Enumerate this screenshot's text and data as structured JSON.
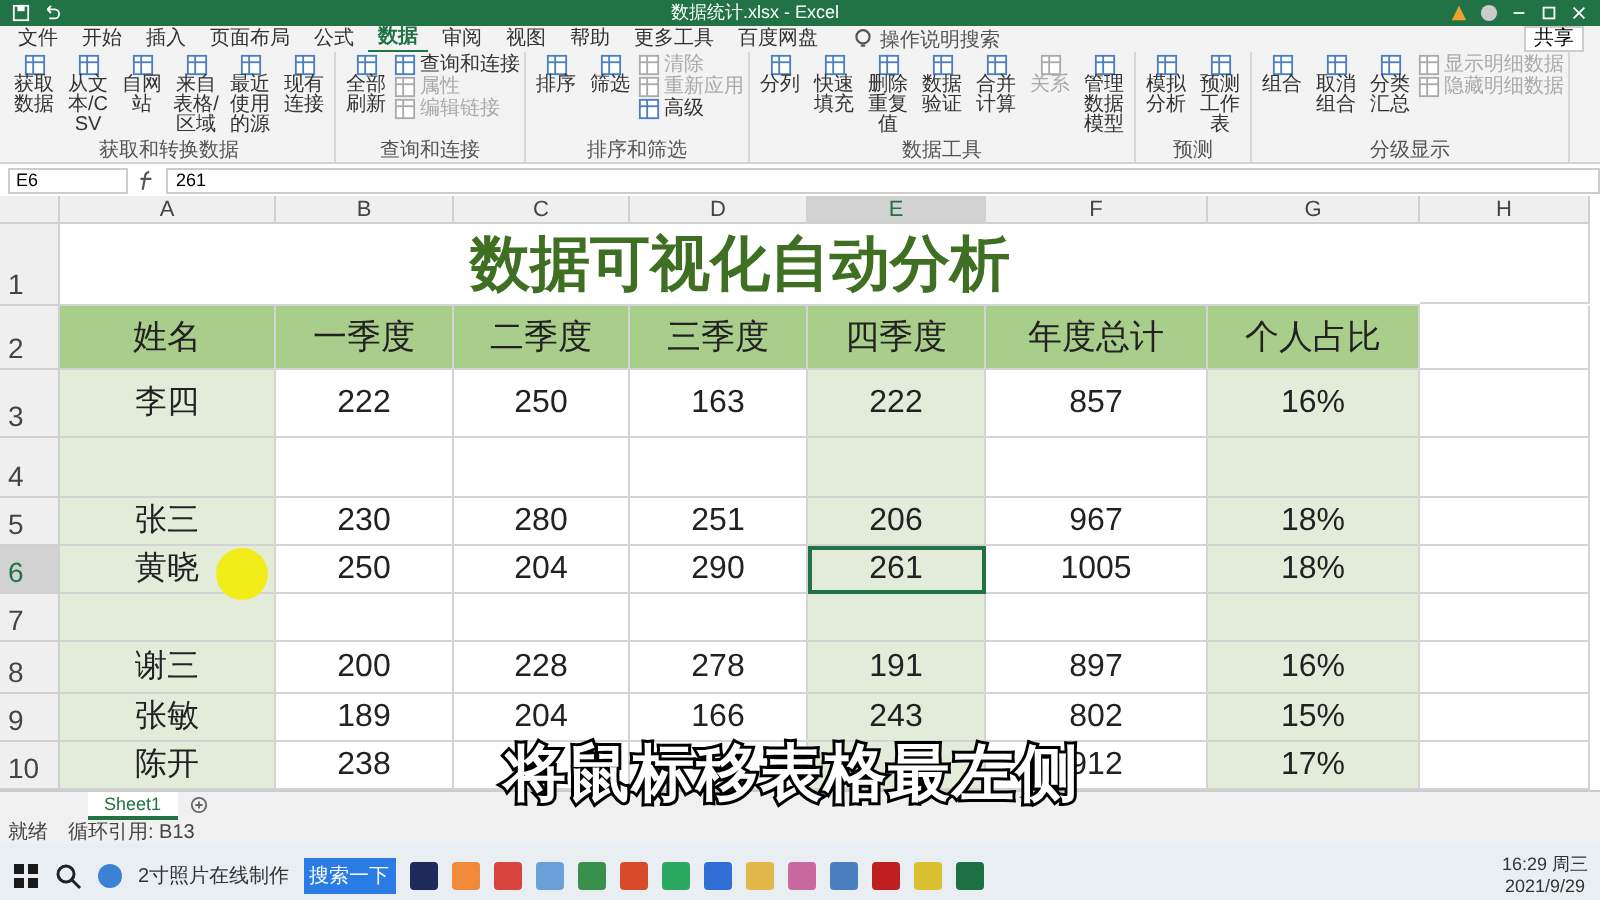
{
  "window": {
    "title": "数据统计.xlsx  -  Excel"
  },
  "tabs": [
    {
      "label": "文件",
      "selected": false
    },
    {
      "label": "开始",
      "selected": false
    },
    {
      "label": "插入",
      "selected": false
    },
    {
      "label": "页面布局",
      "selected": false
    },
    {
      "label": "公式",
      "selected": false
    },
    {
      "label": "数据",
      "selected": true
    },
    {
      "label": "审阅",
      "selected": false
    },
    {
      "label": "视图",
      "selected": false
    },
    {
      "label": "帮助",
      "selected": false
    },
    {
      "label": "更多工具",
      "selected": false
    },
    {
      "label": "百度网盘",
      "selected": false
    }
  ],
  "tell_me": {
    "placeholder": "操作说明搜索"
  },
  "share": "共享",
  "ribbon": [
    {
      "label": "获取和转换数据",
      "items": [
        {
          "label": "获取数据",
          "kind": "large",
          "disabled": false
        },
        {
          "label": "从文本/CSV",
          "kind": "large",
          "disabled": false
        },
        {
          "label": "自网站",
          "kind": "large",
          "disabled": false
        },
        {
          "label": "来自表格/区域",
          "kind": "large",
          "disabled": false
        },
        {
          "label": "最近使用的源",
          "kind": "large",
          "disabled": false
        },
        {
          "label": "现有连接",
          "kind": "large",
          "disabled": false
        }
      ]
    },
    {
      "label": "查询和连接",
      "items": [
        {
          "label": "全部刷新",
          "kind": "large",
          "disabled": false
        },
        {
          "label": "查询和连接",
          "kind": "small",
          "disabled": false
        },
        {
          "label": "属性",
          "kind": "small",
          "disabled": true
        },
        {
          "label": "编辑链接",
          "kind": "small",
          "disabled": true
        }
      ]
    },
    {
      "label": "排序和筛选",
      "items": [
        {
          "label": "排序",
          "kind": "large",
          "disabled": false
        },
        {
          "label": "筛选",
          "kind": "large",
          "disabled": false
        },
        {
          "label": "清除",
          "kind": "small",
          "disabled": true
        },
        {
          "label": "重新应用",
          "kind": "small",
          "disabled": true
        },
        {
          "label": "高级",
          "kind": "small",
          "disabled": false
        }
      ]
    },
    {
      "label": "数据工具",
      "items": [
        {
          "label": "分列",
          "kind": "large",
          "disabled": false
        },
        {
          "label": "快速填充",
          "kind": "large",
          "disabled": false
        },
        {
          "label": "删除重复值",
          "kind": "large",
          "disabled": false
        },
        {
          "label": "数据验证",
          "kind": "large",
          "disabled": false
        },
        {
          "label": "合并计算",
          "kind": "large",
          "disabled": false
        },
        {
          "label": "关系",
          "kind": "large",
          "disabled": true
        },
        {
          "label": "管理数据模型",
          "kind": "large",
          "disabled": false
        }
      ]
    },
    {
      "label": "预测",
      "items": [
        {
          "label": "模拟分析",
          "kind": "large",
          "disabled": false
        },
        {
          "label": "预测工作表",
          "kind": "large",
          "disabled": false
        }
      ]
    },
    {
      "label": "分级显示",
      "items": [
        {
          "label": "组合",
          "kind": "large",
          "disabled": false
        },
        {
          "label": "取消组合",
          "kind": "large",
          "disabled": false
        },
        {
          "label": "分类汇总",
          "kind": "large",
          "disabled": false
        },
        {
          "label": "显示明细数据",
          "kind": "small",
          "disabled": true
        },
        {
          "label": "隐藏明细数据",
          "kind": "small",
          "disabled": true
        }
      ]
    }
  ],
  "name_box": "E6",
  "formula": "261",
  "columns": [
    {
      "letter": "A",
      "shaded": true,
      "selected": false
    },
    {
      "letter": "B",
      "shaded": false,
      "selected": false
    },
    {
      "letter": "C",
      "shaded": false,
      "selected": false
    },
    {
      "letter": "D",
      "shaded": false,
      "selected": false
    },
    {
      "letter": "E",
      "shaded": true,
      "selected": true
    },
    {
      "letter": "F",
      "shaded": false,
      "selected": false
    },
    {
      "letter": "G",
      "shaded": true,
      "selected": false
    },
    {
      "letter": "H",
      "shaded": false,
      "selected": false
    }
  ],
  "rows": [
    {
      "label": "1",
      "kind": "title",
      "title": "数据可视化自动分析",
      "selected": false
    },
    {
      "label": "2",
      "kind": "header",
      "cells": [
        "姓名",
        "一季度",
        "二季度",
        "三季度",
        "四季度",
        "年度总计",
        "个人占比"
      ],
      "selected": false
    },
    {
      "label": "3",
      "kind": "data",
      "cells": [
        "李四",
        "222",
        "250",
        "163",
        "222",
        "857",
        "16%"
      ],
      "selected": false
    },
    {
      "label": "4",
      "kind": "data",
      "selected": false
    },
    {
      "label": "5",
      "kind": "data",
      "cells": [
        "张三",
        "230",
        "280",
        "251",
        "206",
        "967",
        "18%"
      ],
      "selected": false
    },
    {
      "label": "6",
      "kind": "data",
      "cells": [
        "黄晓",
        "250",
        "204",
        "290",
        "261",
        "1005",
        "18%"
      ],
      "selected": true
    },
    {
      "label": "7",
      "kind": "data",
      "selected": false
    },
    {
      "label": "8",
      "kind": "data",
      "cells": [
        "谢三",
        "200",
        "228",
        "278",
        "191",
        "897",
        "16%"
      ],
      "selected": false
    },
    {
      "label": "9",
      "kind": "data",
      "cells": [
        "张敏",
        "189",
        "204",
        "166",
        "243",
        "802",
        "15%"
      ],
      "selected": false
    },
    {
      "label": "10",
      "kind": "data",
      "cells": [
        "陈开",
        "238",
        null,
        null,
        null,
        "912",
        "17%"
      ],
      "selected": false
    }
  ],
  "sheets": [
    {
      "label": "Sheet1",
      "selected": true
    }
  ],
  "status_bar": {
    "mode": "就绪",
    "note": "循环引用: B13"
  },
  "subtitle": "将鼠标移表格最左侧",
  "taskbar": {
    "browser_tab": "2寸照片在线制作",
    "search_button": "搜索一下",
    "time": "16:29 周三",
    "date": "2021/9/29"
  }
}
